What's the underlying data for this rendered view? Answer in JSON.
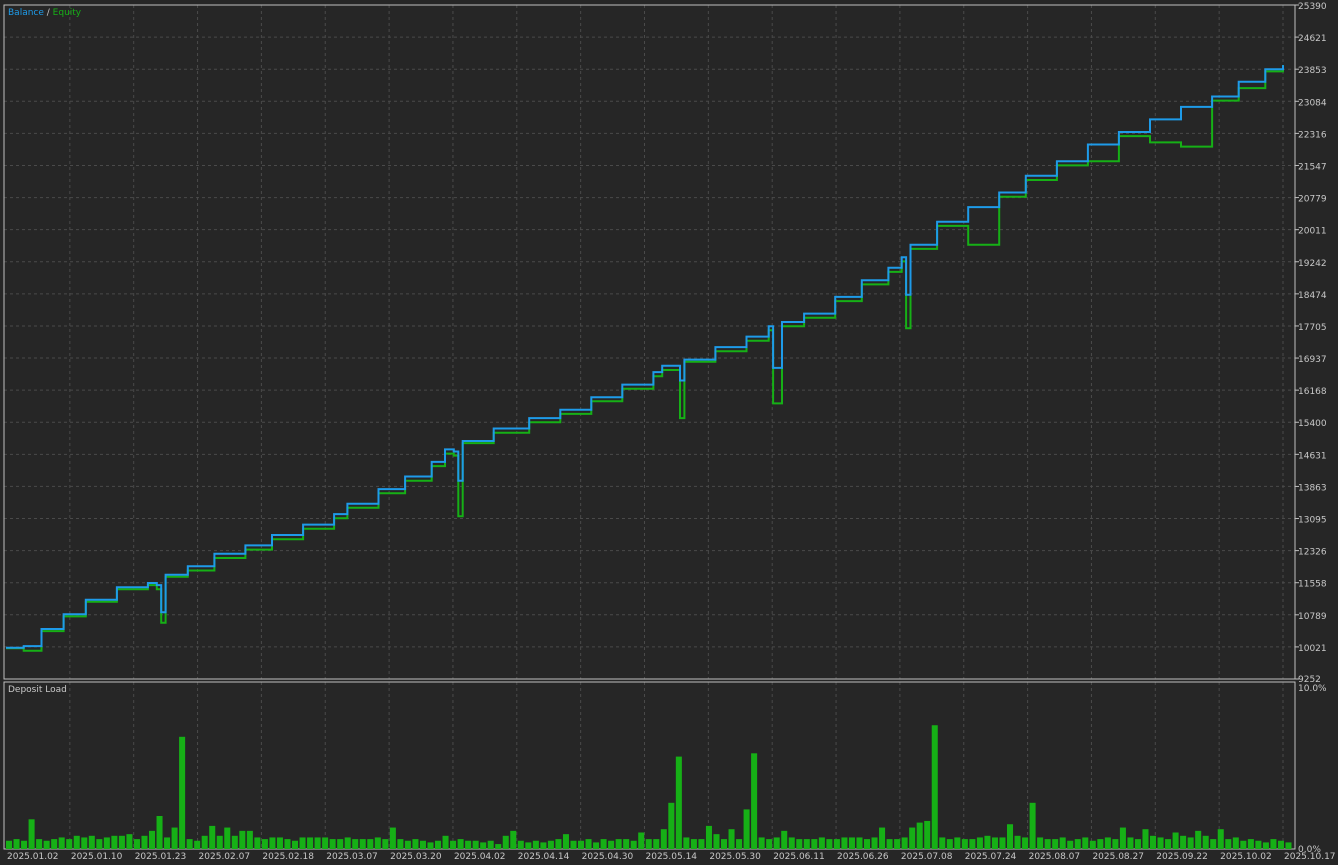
{
  "legend": {
    "balance": "Balance",
    "separator": " / ",
    "equity": "Equity"
  },
  "lower_panel_label": "Deposit Load",
  "colors": {
    "background": "#262626",
    "grid": "#4a4a4a",
    "frame": "#c0c0c0",
    "text": "#c8c8c8",
    "balance": "#1e9be9",
    "equity": "#16b016",
    "deposit_load": "#16b016"
  },
  "chart_data": [
    {
      "type": "line",
      "title": "",
      "ylim": [
        9252,
        25390
      ],
      "y_ticks": [
        "25390",
        "24621",
        "23853",
        "23084",
        "22316",
        "21547",
        "20779",
        "20011",
        "19242",
        "18474",
        "17705",
        "16937",
        "16168",
        "15400",
        "14631",
        "13863",
        "13095",
        "12326",
        "11558",
        "10789",
        "10021",
        "9252"
      ],
      "series": [
        {
          "name": "Balance",
          "points": [
            [
              "2025.01.02",
              10000
            ],
            [
              "2025.01.06",
              10040
            ],
            [
              "2025.01.10",
              10450
            ],
            [
              "2025.01.15",
              10800
            ],
            [
              "2025.01.20",
              11150
            ],
            [
              "2025.01.27",
              11450
            ],
            [
              "2025.02.03",
              11550
            ],
            [
              "2025.02.05",
              11500
            ],
            [
              "2025.02.06",
              10850
            ],
            [
              "2025.02.07",
              11750
            ],
            [
              "2025.02.12",
              11950
            ],
            [
              "2025.02.18",
              12250
            ],
            [
              "2025.02.25",
              12450
            ],
            [
              "2025.03.03",
              12700
            ],
            [
              "2025.03.10",
              12950
            ],
            [
              "2025.03.17",
              13200
            ],
            [
              "2025.03.20",
              13450
            ],
            [
              "2025.03.27",
              13800
            ],
            [
              "2025.04.02",
              14100
            ],
            [
              "2025.04.08",
              14450
            ],
            [
              "2025.04.11",
              14750
            ],
            [
              "2025.04.13",
              14700
            ],
            [
              "2025.04.14",
              14000
            ],
            [
              "2025.04.15",
              14950
            ],
            [
              "2025.04.22",
              15250
            ],
            [
              "2025.04.30",
              15500
            ],
            [
              "2025.05.07",
              15700
            ],
            [
              "2025.05.14",
              16000
            ],
            [
              "2025.05.21",
              16300
            ],
            [
              "2025.05.28",
              16600
            ],
            [
              "2025.05.30",
              16750
            ],
            [
              "2025.06.03",
              16400
            ],
            [
              "2025.06.04",
              16900
            ],
            [
              "2025.06.11",
              17200
            ],
            [
              "2025.06.18",
              17450
            ],
            [
              "2025.06.23",
              17700
            ],
            [
              "2025.06.24",
              16700
            ],
            [
              "2025.06.26",
              17800
            ],
            [
              "2025.07.01",
              18000
            ],
            [
              "2025.07.08",
              18400
            ],
            [
              "2025.07.14",
              18800
            ],
            [
              "2025.07.20",
              19100
            ],
            [
              "2025.07.23",
              19350
            ],
            [
              "2025.07.24",
              18450
            ],
            [
              "2025.07.25",
              19650
            ],
            [
              "2025.07.31",
              20200
            ],
            [
              "2025.08.07",
              20550
            ],
            [
              "2025.08.14",
              20900
            ],
            [
              "2025.08.20",
              21300
            ],
            [
              "2025.08.27",
              21650
            ],
            [
              "2025.09.03",
              22050
            ],
            [
              "2025.09.10",
              22350
            ],
            [
              "2025.09.17",
              22650
            ],
            [
              "2025.09.24",
              22950
            ],
            [
              "2025.10.01",
              23200
            ],
            [
              "2025.10.07",
              23550
            ],
            [
              "2025.10.13",
              23850
            ],
            [
              "2025.10.17",
              23950
            ]
          ]
        },
        {
          "name": "Equity",
          "points": [
            [
              "2025.01.02",
              9990
            ],
            [
              "2025.01.06",
              9930
            ],
            [
              "2025.01.10",
              10400
            ],
            [
              "2025.01.15",
              10750
            ],
            [
              "2025.01.20",
              11100
            ],
            [
              "2025.01.27",
              11400
            ],
            [
              "2025.02.03",
              11500
            ],
            [
              "2025.02.05",
              11400
            ],
            [
              "2025.02.06",
              10600
            ],
            [
              "2025.02.07",
              11700
            ],
            [
              "2025.02.12",
              11850
            ],
            [
              "2025.02.18",
              12150
            ],
            [
              "2025.02.25",
              12350
            ],
            [
              "2025.03.03",
              12600
            ],
            [
              "2025.03.10",
              12850
            ],
            [
              "2025.03.17",
              13100
            ],
            [
              "2025.03.20",
              13350
            ],
            [
              "2025.03.27",
              13700
            ],
            [
              "2025.04.02",
              14000
            ],
            [
              "2025.04.08",
              14350
            ],
            [
              "2025.04.11",
              14650
            ],
            [
              "2025.04.13",
              14600
            ],
            [
              "2025.04.14",
              13150
            ],
            [
              "2025.04.15",
              14900
            ],
            [
              "2025.04.22",
              15150
            ],
            [
              "2025.04.30",
              15400
            ],
            [
              "2025.05.07",
              15600
            ],
            [
              "2025.05.14",
              15900
            ],
            [
              "2025.05.21",
              16200
            ],
            [
              "2025.05.28",
              16500
            ],
            [
              "2025.05.30",
              16650
            ],
            [
              "2025.06.03",
              15500
            ],
            [
              "2025.06.04",
              16850
            ],
            [
              "2025.06.11",
              17100
            ],
            [
              "2025.06.18",
              17350
            ],
            [
              "2025.06.23",
              17600
            ],
            [
              "2025.06.24",
              15850
            ],
            [
              "2025.06.26",
              17700
            ],
            [
              "2025.07.01",
              17900
            ],
            [
              "2025.07.08",
              18300
            ],
            [
              "2025.07.14",
              18700
            ],
            [
              "2025.07.20",
              19000
            ],
            [
              "2025.07.23",
              19250
            ],
            [
              "2025.07.24",
              17650
            ],
            [
              "2025.07.25",
              19550
            ],
            [
              "2025.07.31",
              20100
            ],
            [
              "2025.08.07",
              19650
            ],
            [
              "2025.08.14",
              20800
            ],
            [
              "2025.08.20",
              21200
            ],
            [
              "2025.08.27",
              21550
            ],
            [
              "2025.09.03",
              21650
            ],
            [
              "2025.09.10",
              22250
            ],
            [
              "2025.09.17",
              22100
            ],
            [
              "2025.09.24",
              22000
            ],
            [
              "2025.10.01",
              23100
            ],
            [
              "2025.10.07",
              23400
            ],
            [
              "2025.10.13",
              23800
            ],
            [
              "2025.10.17",
              23950
            ]
          ]
        }
      ]
    },
    {
      "type": "bar",
      "title": "Deposit Load",
      "ylim": [
        0,
        10
      ],
      "y_ticks": [
        "10.0%",
        "0.0%"
      ],
      "x_ticks": [
        "2025.01.02",
        "2025.01.10",
        "2025.01.23",
        "2025.02.07",
        "2025.02.18",
        "2025.03.07",
        "2025.03.20",
        "2025.04.02",
        "2025.04.14",
        "2025.04.30",
        "2025.05.14",
        "2025.05.30",
        "2025.06.11",
        "2025.06.26",
        "2025.07.08",
        "2025.07.24",
        "2025.08.07",
        "2025.08.27",
        "2025.09.22",
        "2025.10.02",
        "2025.10.17"
      ],
      "values": [
        0.5,
        0.6,
        0.5,
        1.8,
        0.6,
        0.5,
        0.6,
        0.7,
        0.6,
        0.8,
        0.7,
        0.8,
        0.6,
        0.7,
        0.8,
        0.8,
        0.9,
        0.6,
        0.8,
        1.1,
        2.0,
        0.7,
        1.3,
        6.8,
        0.6,
        0.5,
        0.8,
        1.4,
        0.8,
        1.3,
        0.8,
        1.1,
        1.1,
        0.7,
        0.6,
        0.7,
        0.7,
        0.6,
        0.5,
        0.7,
        0.7,
        0.7,
        0.7,
        0.6,
        0.6,
        0.7,
        0.6,
        0.6,
        0.6,
        0.7,
        0.6,
        1.3,
        0.6,
        0.5,
        0.6,
        0.5,
        0.4,
        0.5,
        0.8,
        0.5,
        0.6,
        0.5,
        0.5,
        0.4,
        0.5,
        0.3,
        0.8,
        1.1,
        0.5,
        0.4,
        0.5,
        0.4,
        0.5,
        0.6,
        0.9,
        0.5,
        0.5,
        0.6,
        0.4,
        0.6,
        0.5,
        0.6,
        0.6,
        0.5,
        1.0,
        0.6,
        0.6,
        1.2,
        2.8,
        5.6,
        0.7,
        0.6,
        0.6,
        1.4,
        0.9,
        0.6,
        1.2,
        0.6,
        2.4,
        5.8,
        0.7,
        0.6,
        0.7,
        1.1,
        0.7,
        0.6,
        0.6,
        0.6,
        0.7,
        0.6,
        0.6,
        0.7,
        0.7,
        0.7,
        0.6,
        0.7,
        1.3,
        0.6,
        0.6,
        0.7,
        1.3,
        1.6,
        1.7,
        7.5,
        0.7,
        0.6,
        0.7,
        0.6,
        0.6,
        0.7,
        0.8,
        0.7,
        0.7,
        1.5,
        0.8,
        0.7,
        2.8,
        0.7,
        0.6,
        0.6,
        0.7,
        0.5,
        0.6,
        0.7,
        0.5,
        0.6,
        0.7,
        0.6,
        1.3,
        0.7,
        0.6,
        1.2,
        0.8,
        0.7,
        0.6,
        1.0,
        0.8,
        0.7,
        1.1,
        0.8,
        0.6,
        1.2,
        0.6,
        0.7,
        0.5,
        0.6,
        0.5,
        0.4,
        0.6,
        0.5,
        0.4
      ]
    }
  ]
}
